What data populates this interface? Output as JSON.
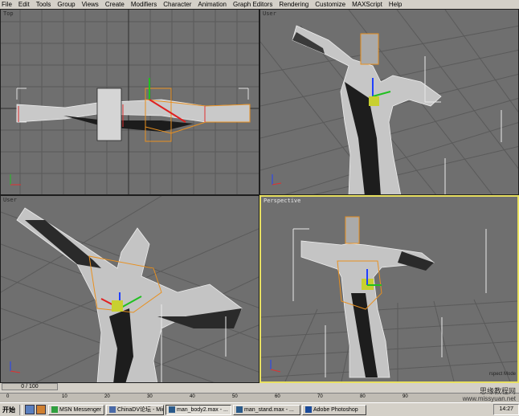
{
  "menu": [
    "File",
    "Edit",
    "Tools",
    "Group",
    "Views",
    "Create",
    "Modifiers",
    "Character",
    "Animation",
    "Graph Editors",
    "Rendering",
    "Customize",
    "MAXScript",
    "Help"
  ],
  "viewports": {
    "top_left": "Top",
    "top_right": "User",
    "bottom_left": "User",
    "bottom_right": "Perspective"
  },
  "time_slider": "0 / 100",
  "track_ticks": [
    "0",
    "10",
    "20",
    "30",
    "40",
    "50",
    "60",
    "70",
    "80",
    "90"
  ],
  "taskbar": {
    "start": "开始",
    "buttons": [
      "MSN Messenger",
      "ChinaDV论坛 - Mic...",
      "man_body2.max - ...",
      "man_stand.max - ...",
      "Adobe Photoshop"
    ],
    "clock": "14:27"
  },
  "watermark": {
    "line1": "思缘教程网",
    "line2": "www.missyuan.net"
  },
  "partial_label": "rspect Mode",
  "colors": {
    "viewport_bg": "#6f6f6f",
    "grid": "#5a5a5a",
    "selection": "#e89020",
    "active_border": "#e8e060"
  }
}
